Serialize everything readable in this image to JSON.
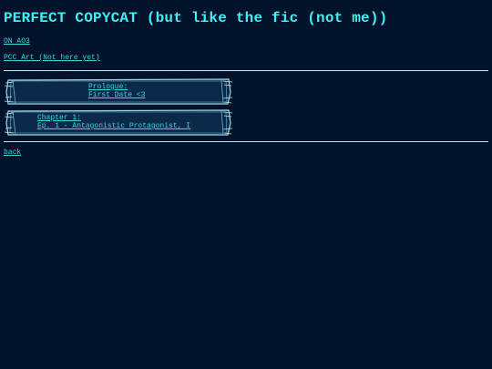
{
  "page": {
    "title": "PERFECT COPYCAT (but like the fic (not me))"
  },
  "links": {
    "ao3": "ON AO3",
    "art": "PCC Art (Not here yet)",
    "back": "back"
  },
  "chapters": [
    {
      "line1": "Prologue:",
      "line2": "First Date <3"
    },
    {
      "line1": "Chapter 1:",
      "line2": "Ep. 1 - Antagonistic Protagonist, I"
    }
  ],
  "colors": {
    "background": "#00132b",
    "accent": "#3ff0f6",
    "link": "#36d6e0",
    "card_fill": "#0b2a4a",
    "card_border": "#9fd8e6"
  }
}
